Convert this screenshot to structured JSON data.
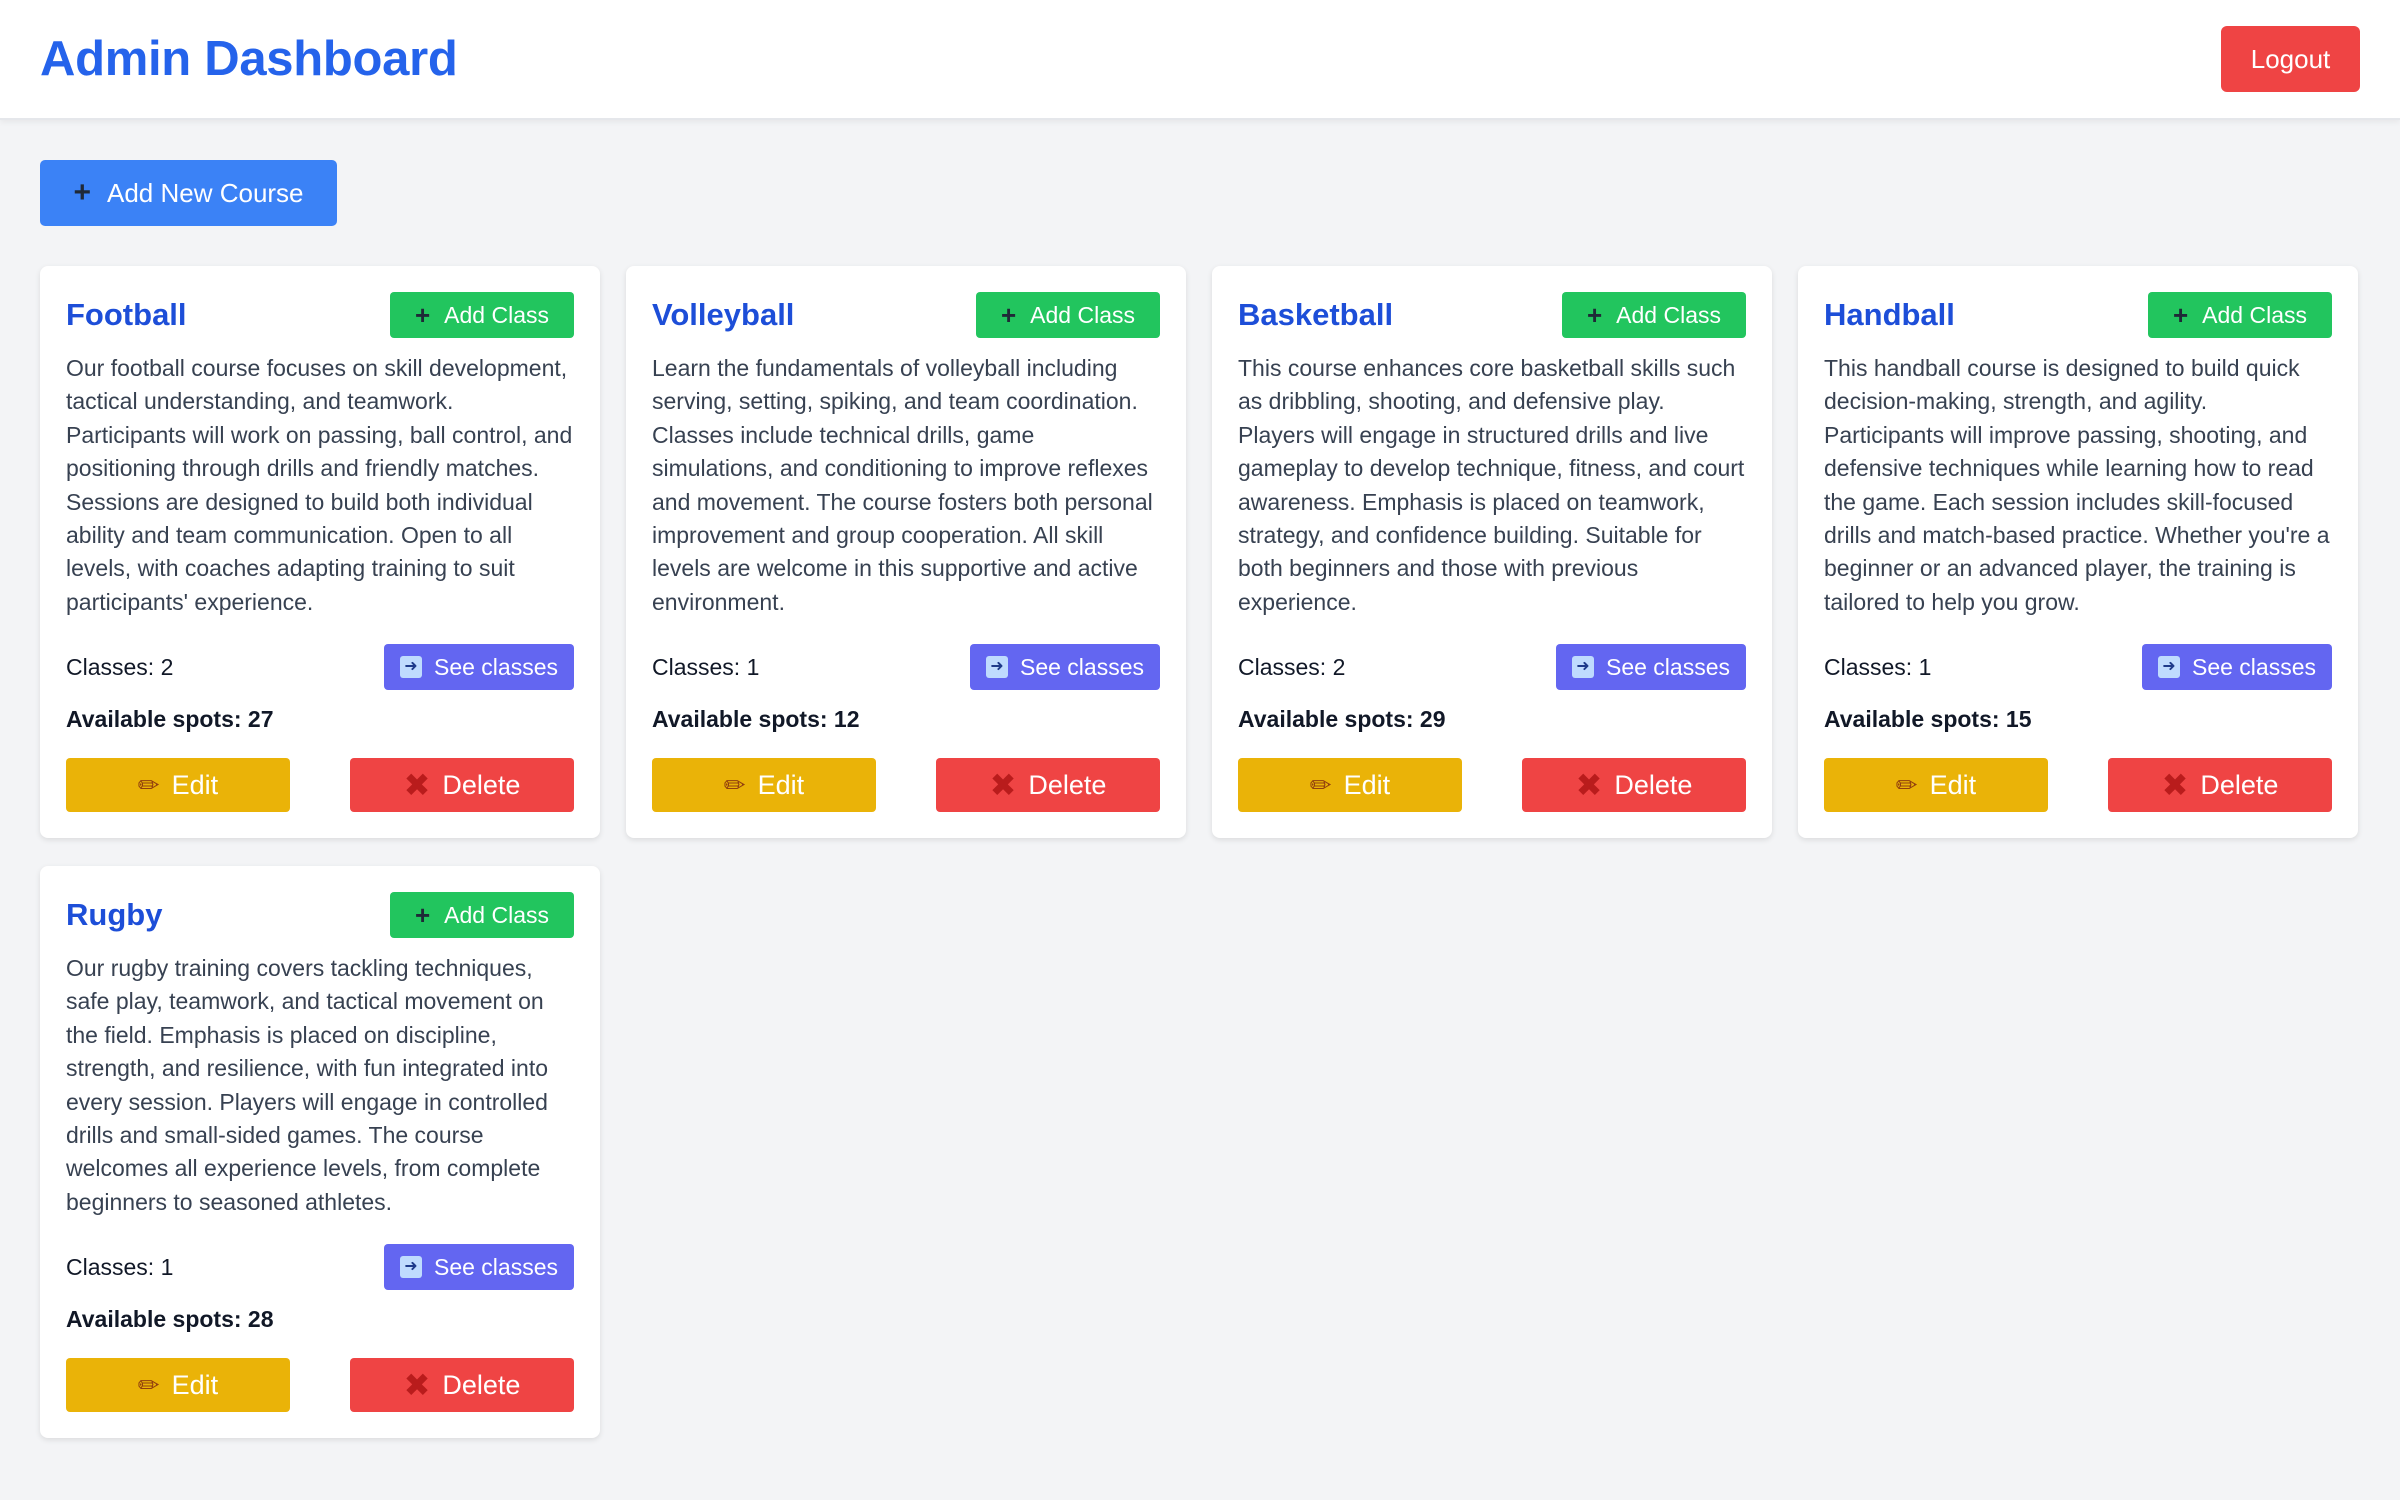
{
  "header": {
    "title": "Admin Dashboard",
    "logout_label": "Logout"
  },
  "toolbar": {
    "add_course_label": "Add New Course"
  },
  "labels": {
    "add_class": "Add Class",
    "see_classes": "See classes",
    "edit": "Edit",
    "delete": "Delete"
  },
  "courses": [
    {
      "name": "Football",
      "description": "Our football course focuses on skill development, tactical understanding, and teamwork. Participants will work on passing, ball control, and positioning through drills and friendly matches. Sessions are designed to build both individual ability and team communication. Open to all levels, with coaches adapting training to suit participants' experience.",
      "classes": "Classes: 2",
      "spots": "Available spots: 27"
    },
    {
      "name": "Volleyball",
      "description": "Learn the fundamentals of volleyball including serving, setting, spiking, and team coordination. Classes include technical drills, game simulations, and conditioning to improve reflexes and movement. The course fosters both personal improvement and group cooperation. All skill levels are welcome in this supportive and active environment.",
      "classes": "Classes: 1",
      "spots": "Available spots: 12"
    },
    {
      "name": "Basketball",
      "description": "This course enhances core basketball skills such as dribbling, shooting, and defensive play. Players will engage in structured drills and live gameplay to develop technique, fitness, and court awareness. Emphasis is placed on teamwork, strategy, and confidence building. Suitable for both beginners and those with previous experience.",
      "classes": "Classes: 2",
      "spots": "Available spots: 29"
    },
    {
      "name": "Handball",
      "description": "This handball course is designed to build quick decision-making, strength, and agility. Participants will improve passing, shooting, and defensive techniques while learning how to read the game. Each session includes skill-focused drills and match-based practice. Whether you're a beginner or an advanced player, the training is tailored to help you grow.",
      "classes": "Classes: 1",
      "spots": "Available spots: 15"
    },
    {
      "name": "Rugby",
      "description": "Our rugby training covers tackling techniques, safe play, teamwork, and tactical movement on the field. Emphasis is placed on discipline, strength, and resilience, with fun integrated into every session. Players will engage in controlled drills and small-sided games. The course welcomes all experience levels, from complete beginners to seasoned athletes.",
      "classes": "Classes: 1",
      "spots": "Available spots: 28"
    }
  ],
  "colors": {
    "brand_blue": "#2563eb",
    "add_course": "#3b82f6",
    "add_class": "#22c55e",
    "see_classes": "#6366f1",
    "edit": "#eab308",
    "delete": "#ef4444",
    "logout": "#ef4444"
  },
  "icons": {
    "add": "plus-icon",
    "see_classes": "arrow-right-icon",
    "edit": "pencil-icon",
    "delete": "x-icon"
  }
}
